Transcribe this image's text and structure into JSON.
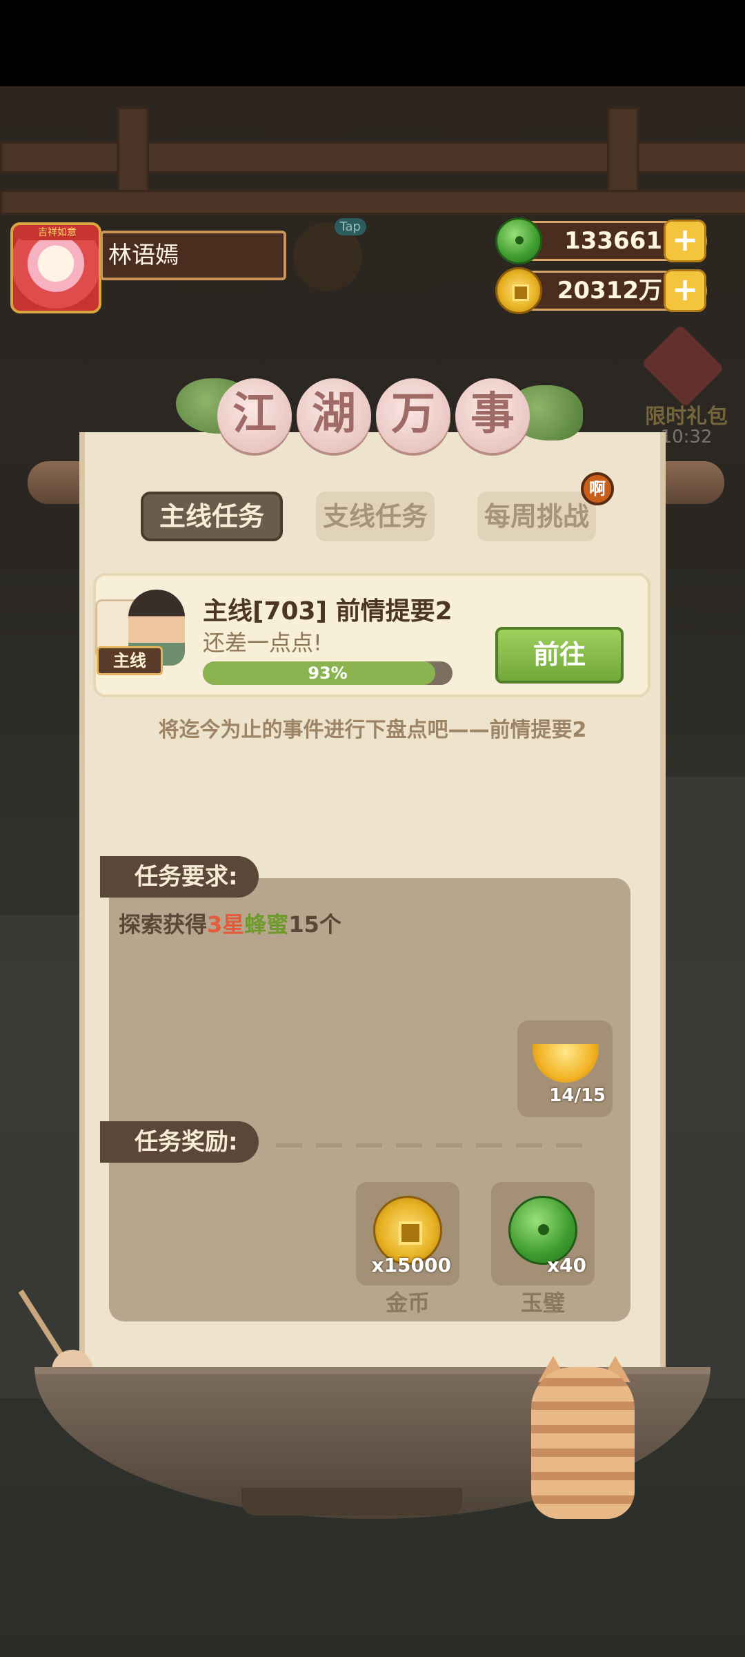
{
  "player": {
    "name": "林语嫣",
    "avatar_badge": "吉祥如意",
    "tap_label": "Tap"
  },
  "resources": {
    "jade": "133661",
    "coins": "20312万"
  },
  "gift": {
    "label": "限时礼包",
    "timer": "10:32"
  },
  "panel": {
    "title_chars": [
      "江",
      "湖",
      "万",
      "事"
    ],
    "tabs": {
      "main": "主线任务",
      "side": "支线任务",
      "weekly": "每周挑战"
    },
    "weekly_badge": "啊"
  },
  "quest": {
    "tag": "主线",
    "title": "主线[703] 前情提要2",
    "subtitle": "还差一点点!",
    "progress_percent": 93,
    "progress_label": "93%",
    "go_button": "前往",
    "description": "将迄今为止的事件进行下盘点吧——前情提要2"
  },
  "requirement": {
    "label": "任务要求:",
    "text_prefix": "探索获得",
    "text_star": "3星",
    "text_item": "蜂蜜",
    "text_suffix": "15个",
    "item_count": "14/15"
  },
  "rewards": {
    "label": "任务奖励:",
    "items": [
      {
        "name": "金币",
        "qty": "x15000",
        "icon": "gold-coin-icon"
      },
      {
        "name": "玉璧",
        "qty": "x40",
        "icon": "jade-disc-icon"
      }
    ]
  },
  "colors": {
    "accent_green": "#8ab34f",
    "panel_bg": "#eee3cc",
    "label_bg": "#5a4737"
  }
}
